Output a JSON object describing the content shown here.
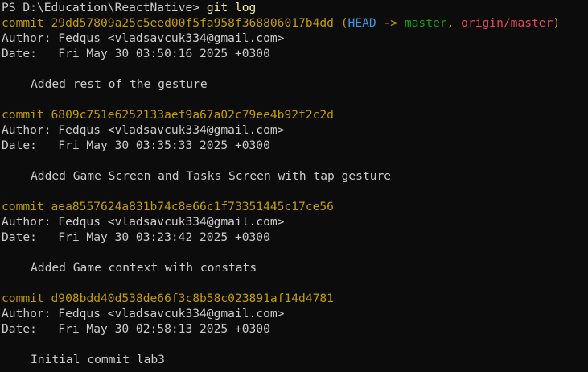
{
  "prompt": {
    "text": "PS D:\\Education\\ReactNative> ",
    "command": "git log"
  },
  "commits": [
    {
      "hash": "29dd57809a25c5eed00f5fa958f368806017b4dd",
      "refs": {
        "open": " (",
        "head": "HEAD",
        "arrow": " -> ",
        "local": "master",
        "sep": ", ",
        "remote": "origin/master",
        "close": ")"
      },
      "author": "Author: Fedqus <vladsavcuk334@gmail.com>",
      "date": "Date:   Fri May 30 03:50:16 2025 +0300",
      "message": "Added rest of the gesture"
    },
    {
      "hash": "6809c751e6252133aef9a67a02c79ee4b92f2c2d",
      "author": "Author: Fedqus <vladsavcuk334@gmail.com>",
      "date": "Date:   Fri May 30 03:35:33 2025 +0300",
      "message": "Added Game Screen and Tasks Screen with tap gesture"
    },
    {
      "hash": "aea8557624a831b74c8e66c1f73351445c17ce56",
      "author": "Author: Fedqus <vladsavcuk334@gmail.com>",
      "date": "Date:   Fri May 30 03:23:42 2025 +0300",
      "message": "Added Game context with constats"
    },
    {
      "hash": "d908bdd40d538de66f3c8b58c023891af14d4781",
      "author": "Author: Fedqus <vladsavcuk334@gmail.com>",
      "date": "Date:   Fri May 30 02:58:13 2025 +0300",
      "message": "Initial commit lab3"
    }
  ],
  "labels": {
    "commit": "commit "
  },
  "colors": {
    "background": "#0c0c0c",
    "text": "#cccccc",
    "commit": "#c19c00",
    "head": "#3a96dd",
    "local_branch": "#13a10e",
    "remote_branch": "#e74856",
    "command": "#f9f1a5"
  }
}
